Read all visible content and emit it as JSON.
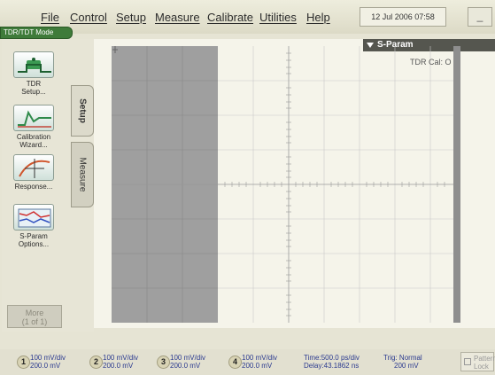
{
  "menu": {
    "items": [
      "File",
      "Control",
      "Setup",
      "Measure",
      "Calibrate",
      "Utilities",
      "Help"
    ],
    "datetime": "12 Jul 2006  07:58",
    "minimize_label": "_"
  },
  "mode_tag": "TDR/TDT Mode",
  "left_panel": {
    "tabs": {
      "setup": "Setup",
      "measure": "Measure"
    },
    "tools": [
      {
        "label": "TDR\nSetup...",
        "icon": "tdr-setup-icon"
      },
      {
        "label": "Calibration\nWizard...",
        "icon": "calibration-wizard-icon"
      },
      {
        "label": "Response...",
        "icon": "response-icon"
      },
      {
        "label": "S-Param\nOptions...",
        "icon": "s-param-options-icon"
      }
    ],
    "more_label": "More",
    "more_page": "(1 of 1)"
  },
  "display": {
    "tab_label": "S-Param",
    "tdr_cal": "TDR Cal:  O"
  },
  "status": {
    "channels": [
      {
        "num": "1",
        "scale": "100 mV/div",
        "offset": "200.0 mV"
      },
      {
        "num": "2",
        "scale": "100 mV/div",
        "offset": "200.0 mV"
      },
      {
        "num": "3",
        "scale": "100 mV/div",
        "offset": "200.0 mV"
      },
      {
        "num": "4",
        "scale": "100 mV/div",
        "offset": "200.0 mV"
      }
    ],
    "time": "Time:500.0 ps/div",
    "delay": "Delay:43.1862 ns",
    "trig": "Trig: Normal",
    "trig_level": "200 mV",
    "pattern": "Pattern",
    "lock": "Lock"
  },
  "colors": {
    "accent_green": "#3f7b3a",
    "status_text": "#2b3a8f",
    "shaded_region": "#9f9f9f",
    "grid_line": "#c8c8c8"
  }
}
